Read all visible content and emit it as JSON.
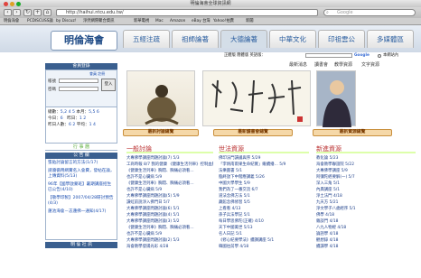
{
  "window": {
    "title": "明倫海會全球資訊網"
  },
  "toolbar": {
    "url": "http://haihui.ntcu.edu.tw/",
    "search_placeholder": "Google"
  },
  "bookmarks": [
    "明倫海會",
    "PCDISCUSS論",
    "by Discuz!",
    "淨然網際聚合資訊",
    "新華電視",
    "Mac",
    "Amazon",
    "eBay 台灣",
    "Yahoo!拍賣",
    "新聞"
  ],
  "site": {
    "logo": "明倫海會",
    "tabs": [
      "五經注疏",
      "祖師論著",
      "大德論著",
      "中華文化",
      "印祖雲公",
      "多媒體區"
    ],
    "subnav_left": "正體版  簡體版  英語版：",
    "subnav_right": "本網站內",
    "main_tabs": [
      "最新消息",
      "讀書會",
      "教學資源",
      "文字資源"
    ]
  },
  "sidebar": {
    "member_title": "會員登錄",
    "member_links": "會員 註冊",
    "account_label": "帳號",
    "password_label": "密碼",
    "login_button": "登入",
    "stats": [
      {
        "label": "總數：",
        "value": "5,2 4 5",
        "label2": "本月：",
        "value2": "5,5 6"
      },
      {
        "label": "今日：",
        "value": "6",
        "label2": "昨日：",
        "value2": "1 2"
      },
      {
        "label": "昨日人數：",
        "value": "6 2",
        "label2": "平均：",
        "value2": "1 4"
      }
    ],
    "calendar_title": "行 事 曆",
    "announce_title": "公 告 欄",
    "announce_items": [
      "張貼討論留言的方法(1/17)",
      "請遵循用網實名入會費，發帖在論，上傳資料(5/13)",
      "96年【國學啟蒙班】暑期講座招生已公告(4/10)",
      "【敬學印製】2007/04/28研討預告(4/3)",
      "蓮池海會－志蓮佛一通知(4/17)"
    ],
    "footer_title": "明 倫 社 訊"
  },
  "banners": [
    "最新討論總覽",
    "最新讀書會總覽",
    "最新資源總覽"
  ],
  "lists": {
    "discussion": {
      "title": "一般討論",
      "items": [
        "大專佛學講座問題討論(7) 5/3",
        "工商時報 8/7 我的健康 《健康生活列車》控制血壓 5/9",
        "《健康生活列車》胸悶、胸痛必須看…",
        "也許不是心臟病 5/9",
        "《健康生活列車》胸悶、胸痛必須看…",
        "也許不是心臟病 5/9",
        "大專佛學講座問題討論(5) 5/9",
        "讀虹前說淨入佛門日 5/7",
        "大專佛學講座問題討論(6) 5/1",
        "大專佛學講座問題討論(4) 5/1",
        "大專佛學講座問題討論(3) 5/2",
        "《健康生活列車》胸悶、胸痛必須看…",
        "也許不是心臟病 5/9",
        "大專佛學講座問題討論(2) 5/3",
        "海會教學發揚光彩 4/28"
      ]
    },
    "study": {
      "title": "世法資源",
      "items": [
        "佛印法門讀誦與序 5/29",
        "「李炳南雨果生命紀實」繼續播… 5/9",
        "法樂圖書 5/1",
        "臨終放下中階應講義 5/26",
        "中國大學學生 5/9",
        "我們為了一番交流 6/7",
        "道法念佛方法 5/1",
        "藏館念佛修習 5/5",
        "上看看 4/13",
        "孫子兵法學記 5/1",
        "每日學思佛陀(正確) 4/10",
        "天下中國萬世 5/13",
        "名人日記 5/1",
        "《修心紀要學法》續講講座 5/1",
        "韓國往前學 4/18"
      ]
    },
    "resources": {
      "title": "新進資源",
      "items": [
        "教化論 5/23",
        "海會教學聯誼院 5/22",
        "大專佛學講座 5/9",
        "阿彌陀經要解(一) 5/7",
        "深入三角 5/1",
        "內典講座 5/1",
        "淨土法門 4/18",
        "九天方 5/21",
        "淨文學子八歲經序 5/1",
        "佛學 4/18",
        "雜談門 4/18",
        "八九人物經 4/18",
        "論語學 4/18",
        "觀想錄 4/18",
        "續讀學 4/18"
      ]
    }
  }
}
